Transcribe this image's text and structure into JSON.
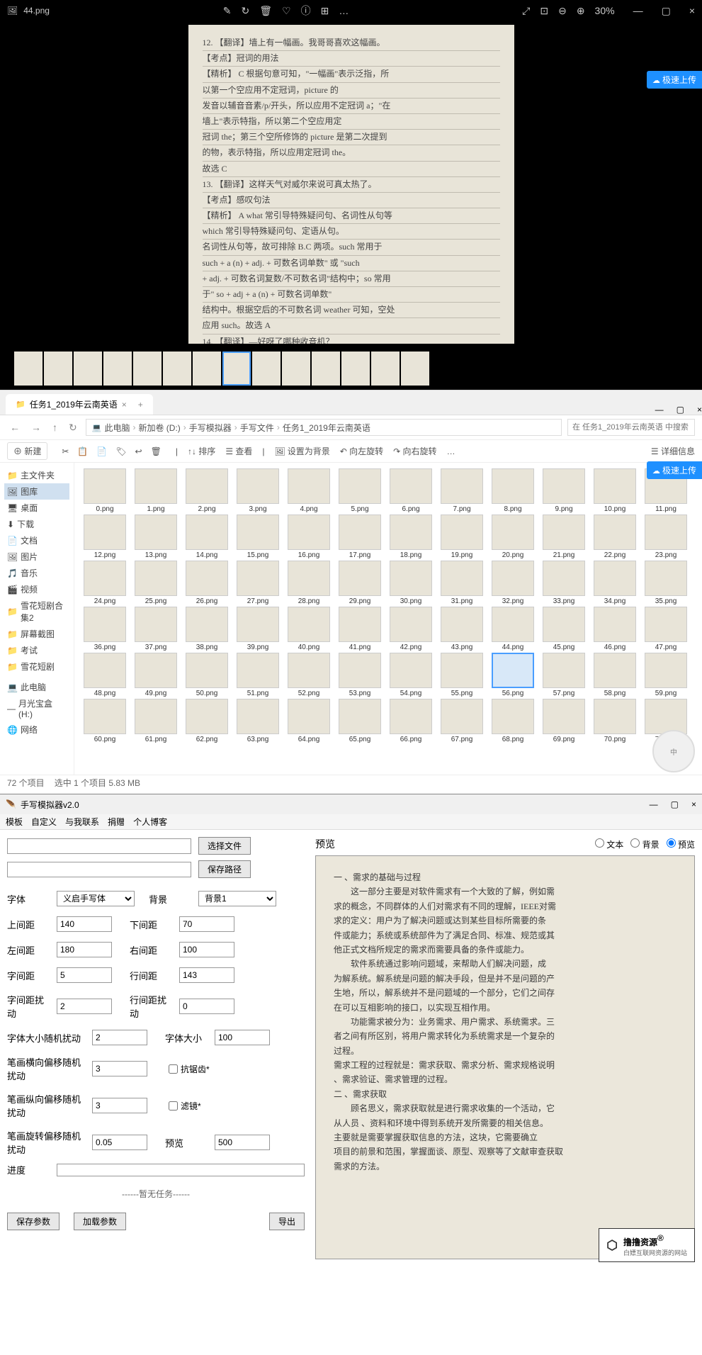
{
  "viewer": {
    "filename": "44.png",
    "zoom": "30%",
    "icons": [
      "✎",
      "↻",
      "🗑",
      "♡",
      "ⓘ",
      "⊞",
      "…"
    ],
    "right_icons": [
      "⤢",
      "⊡",
      "⊖",
      "⊕"
    ],
    "cloud": "极速上传",
    "paper_lines": [
      "12. 【翻译】墙上有一幅画。我哥哥喜欢这幅画。",
      "【考点】冠词的用法",
      "【精析】 C  根据句意可知，\"一幅画\"表示泛指，所",
      "以第一个空应用不定冠词，picture 的",
      "发音以辅音音素/p/开头，所以应用不定冠词 a；\"在",
      "墙上\"表示特指，所以第二个空应用定",
      "冠词 the；第三个空所修饰的 picture 是第二次提到",
      "的物，表示特指，所以应用定冠词 the。",
      "故选 C",
      "13. 【翻译】这样天气对威尔来说可真太热了。",
      "【考点】感叹句法",
      "【精析】 A  what 常引导特殊疑问句、名词性从句等",
      "which 常引导特殊疑问句、定语从句。",
      "名词性从句等，故可排除 B.C 两项。such 常用于",
      "such + a (n) + adj. + 可数名词单数\" 或 \"such",
      "+ adj. + 可数名词复数/不可数名词\"结构中；so 常用",
      "于\" so + adj + a (n) + 可数名词单数\"",
      "结构中。根据空后的不可数名词 weather 可知，空处",
      "应用 such。故选 A",
      "14. 【翻译】—好呀了哪种收音机？"
    ],
    "thumbs": 14,
    "thumb_sel": 7
  },
  "explorer": {
    "tab": "任务1_2019年云南英语",
    "nav": [
      "←",
      "→",
      "↑",
      "↻"
    ],
    "crumbs": [
      "此电脑",
      "新加卷 (D:)",
      "手写模拟器",
      "手写文件",
      "任务1_2019年云南英语"
    ],
    "search_ph": "在 任务1_2019年云南英语 中搜索",
    "toolbar": {
      "new": "⊕ 新建",
      "icons": [
        "✂",
        "📋",
        "📄",
        "🏷",
        "↩",
        "🗑"
      ],
      "sort": "↑↓ 排序",
      "view": "☰ 查看",
      "bg": "设置为背景",
      "rotl": "↶ 向左旋转",
      "rotr": "↷ 向右旋转",
      "detail": "☰ 详细信息"
    },
    "sidebar": [
      {
        "icon": "📁",
        "t": "主文件夹"
      },
      {
        "icon": "🖼",
        "t": "图库",
        "sel": true
      },
      {
        "icon": "🖥",
        "t": "桌面"
      },
      {
        "icon": "⬇",
        "t": "下载"
      },
      {
        "icon": "📄",
        "t": "文档"
      },
      {
        "icon": "🖼",
        "t": "图片"
      },
      {
        "icon": "🎵",
        "t": "音乐"
      },
      {
        "icon": "🎬",
        "t": "视频"
      },
      {
        "icon": "📁",
        "t": "雪花短剧合集2"
      },
      {
        "icon": "📁",
        "t": "屏幕截图"
      },
      {
        "icon": "📁",
        "t": "考试"
      },
      {
        "icon": "📁",
        "t": "雪花短剧"
      },
      {
        "icon": "",
        "t": ""
      },
      {
        "icon": "💻",
        "t": "此电脑"
      },
      {
        "icon": "—",
        "t": "月光宝盒 (H:)"
      },
      {
        "icon": "🌐",
        "t": "网络"
      }
    ],
    "rows": 6,
    "cols": 12,
    "sel_file": 56,
    "status": {
      "count": "72 个项目",
      "sel": "选中 1 个项目  5.83 MB"
    },
    "cloud": "极速上传",
    "avatar": "中"
  },
  "app": {
    "title": "手写模拟器v2.0",
    "menu": [
      "模板",
      "自定义",
      "与我联系",
      "捐赠",
      "个人博客"
    ],
    "btn_file": "选择文件",
    "btn_path": "保存路径",
    "font_lbl": "字体",
    "font_val": "义启手写体",
    "bg_lbl": "背景",
    "bg_val": "背景1",
    "p": [
      {
        "l": "上间距",
        "v": "140",
        "r": "下间距",
        "rv": "70"
      },
      {
        "l": "左间距",
        "v": "180",
        "r": "右间距",
        "rv": "100"
      },
      {
        "l": "字间距",
        "v": "5",
        "r": "行间距",
        "rv": "143"
      },
      {
        "l": "字间距扰动",
        "v": "2",
        "r": "行间距扰动",
        "rv": "0"
      },
      {
        "l": "字体大小随机扰动",
        "v": "2",
        "r": "字体大小",
        "rv": "100"
      },
      {
        "l": "笔画横向偏移随机扰动",
        "v": "3",
        "c": "抗锯齿*"
      },
      {
        "l": "笔画纵向偏移随机扰动",
        "v": "3",
        "c": "滤镜*"
      },
      {
        "l": "笔画旋转偏移随机扰动",
        "v": "0.05",
        "r": "预览",
        "rv": "500"
      }
    ],
    "progress": "进度",
    "task": "------暂无任务------",
    "btns": [
      "保存参数",
      "加载参数"
    ],
    "export": "导出",
    "preview_lbl": "预览",
    "radios": [
      "文本",
      "背景",
      "预览"
    ],
    "radio_sel": 2,
    "preview_text": [
      "一 、需求的基础与过程",
      "　　这一部分主要是对软件需求有一个大致的了解，例如需",
      "求的概念，不同群体的人们对需求有不同的理解，IEEE对需",
      "求的定义：用户为了解决问题或达到某些目标所需要的条",
      "件或能力；系统或系统部件为了满足合同、标准、规范或其",
      "他正式文档所规定的需求而需要具备的条件或能力。",
      "　　软件系统通过影响问题域，来帮助人们解决问题，成",
      "为解系统。解系统是问题的解决手段，但是并不是问题的产",
      "生地，所以，解系统并不是问题域的一个部分，它们之间存",
      "在可以互相影响的接口，以实现互相作用。",
      "　　功能需求被分为：业务需求、用户需求、系统需求。三",
      "者之间有所区别，将用户需求转化为系统需求是一个复杂的",
      "过程。",
      "需求工程的过程就是：需求获取、需求分析、需求规格说明",
      "、需求验证、需求管理的过程。",
      "二 、需求获取",
      "　　顾名思义，需求获取就是进行需求收集的一个活动，它",
      "从人员 、资料和环境中得到系统开发所需要的相关信息。",
      " 主要就是需要掌握获取信息的方法，这块，它需要确立",
      "项目的前景和范围，掌握面谈、原型、观察等了文献审查获取",
      "需求的方法。"
    ]
  },
  "watermark": {
    "name": "撸撸资源",
    "reg": "®",
    "sub": "白嫖互联网资源的网站"
  }
}
